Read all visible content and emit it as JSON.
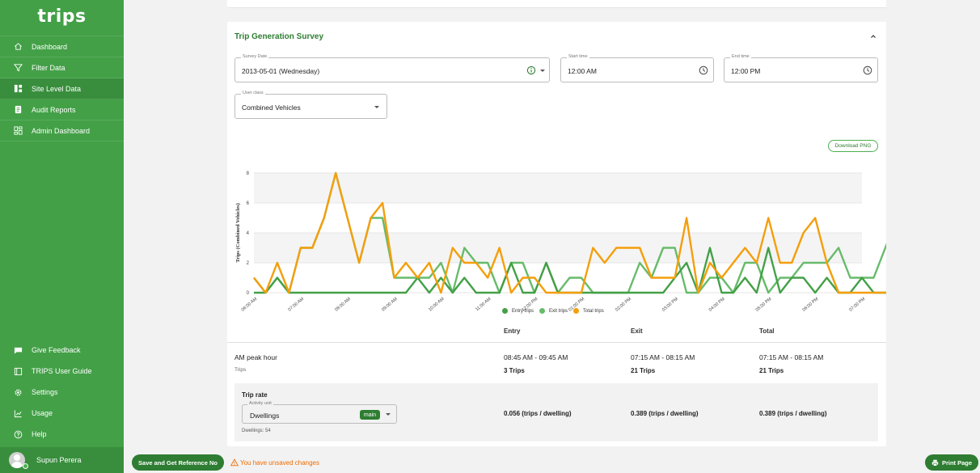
{
  "app": {
    "logo": "trips"
  },
  "sidebar": {
    "items": [
      {
        "label": "Dashboard",
        "icon": "home-icon"
      },
      {
        "label": "Filter Data",
        "icon": "filter-icon"
      },
      {
        "label": "Site Level Data",
        "icon": "grid-icon"
      },
      {
        "label": "Audit Reports",
        "icon": "report-icon"
      },
      {
        "label": "Admin Dashboard",
        "icon": "dashboard-icon"
      }
    ],
    "bottom_items": [
      {
        "label": "Give Feedback",
        "icon": "feedback-icon"
      },
      {
        "label": "TRIPS User Guide",
        "icon": "guide-icon"
      },
      {
        "label": "Settings",
        "icon": "gear-icon"
      },
      {
        "label": "Usage",
        "icon": "chart-icon"
      },
      {
        "label": "Help",
        "icon": "help-icon"
      }
    ],
    "user_name": "Supun Perera"
  },
  "survey": {
    "title": "Trip Generation Survey",
    "survey_date_label": "Survey Date",
    "survey_date": "2013-05-01 (Wednesday)",
    "start_time_label": "Start time",
    "start_time": "12:00 AM",
    "end_time_label": "End time",
    "end_time": "12:00 PM",
    "user_class_label": "User class",
    "user_class": "Combined Vehicles",
    "download_label": "Download PNG"
  },
  "chart_data": {
    "type": "line",
    "ylabel": "Trips (Combined Vehicles)",
    "ylim": [
      0,
      8
    ],
    "yticks": [
      0,
      2,
      4,
      6,
      8
    ],
    "grid": true,
    "legend_position": "bottom",
    "x_tick_labels": [
      "06:00 AM",
      "07:00 AM",
      "08:00 AM",
      "09:00 AM",
      "10:00 AM",
      "11:00 AM",
      "12:00 PM",
      "01:00 PM",
      "02:00 PM",
      "03:00 PM",
      "04:00 PM",
      "05:00 PM",
      "06:00 PM",
      "07:00 PM"
    ],
    "points_per_hour": 4,
    "series": [
      {
        "name": "Entry trips",
        "color": "#43a047",
        "values": [
          0,
          0,
          1,
          0,
          0,
          0,
          0,
          0,
          0,
          0,
          0,
          0,
          0,
          0,
          1,
          0,
          1,
          0,
          1,
          0,
          0,
          0,
          2,
          0,
          0,
          2,
          0,
          0,
          0,
          0,
          0,
          0,
          0,
          0,
          0,
          0,
          1,
          2,
          0,
          3,
          0,
          0,
          1,
          0,
          3,
          0,
          1,
          1,
          0,
          1,
          0,
          0,
          1,
          0,
          0,
          0,
          1,
          2,
          1,
          0,
          0,
          0,
          0,
          0
        ]
      },
      {
        "name": "Exit trips",
        "color": "#66bb6a",
        "values": [
          1,
          0,
          1,
          0,
          3,
          3,
          5,
          8,
          5,
          2,
          5,
          5,
          1,
          1,
          1,
          1,
          2,
          0,
          3,
          2,
          2,
          0,
          2,
          2,
          0,
          2,
          0,
          1,
          1,
          0,
          0,
          0,
          0,
          2,
          1,
          3,
          3,
          0,
          0,
          1,
          1,
          0,
          2,
          2,
          0,
          1,
          1,
          2,
          2,
          2,
          3,
          1,
          1,
          1,
          3,
          5,
          2,
          0,
          0,
          0,
          0,
          0,
          0,
          0
        ]
      },
      {
        "name": "Total trips",
        "color": "#f59e0b",
        "values": [
          1,
          0,
          2,
          0,
          3,
          3,
          5,
          8,
          5,
          2,
          5,
          6,
          1,
          2,
          1,
          2,
          0,
          3,
          2,
          2,
          1,
          3,
          0,
          1,
          1,
          0,
          0,
          0,
          0,
          3,
          2,
          3,
          3,
          3,
          1,
          1,
          1,
          5,
          0,
          2,
          1,
          2,
          3,
          2,
          5,
          2,
          2,
          4,
          5,
          2,
          0,
          0,
          0,
          0,
          0,
          0,
          0,
          0,
          0,
          0,
          0,
          0,
          0,
          0
        ]
      }
    ]
  },
  "table": {
    "headers": {
      "entry": "Entry",
      "exit": "Exit",
      "total": "Total"
    },
    "peak": {
      "name": "AM peak hour",
      "sub": "Trips",
      "entry_time": "08:45 AM - 09:45 AM",
      "entry_trips": "3 Trips",
      "exit_time": "07:15 AM - 08:15 AM",
      "exit_trips": "21 Trips",
      "total_time": "07:15 AM - 08:15 AM",
      "total_trips": "21 Trips"
    },
    "rate": {
      "name": "Trip rate",
      "activity_label": "Activity unit",
      "activity_value": "Dwellings",
      "badge": "main",
      "dwellings_count": "Dwellings: 54",
      "entry": "0.056 (trips / dwelling)",
      "exit": "0.389 (trips / dwelling)",
      "total": "0.389 (trips / dwelling)"
    }
  },
  "footer": {
    "save_label": "Save and Get Reference No",
    "unsaved_label": "You have unsaved changes",
    "print_label": "Print Page"
  }
}
